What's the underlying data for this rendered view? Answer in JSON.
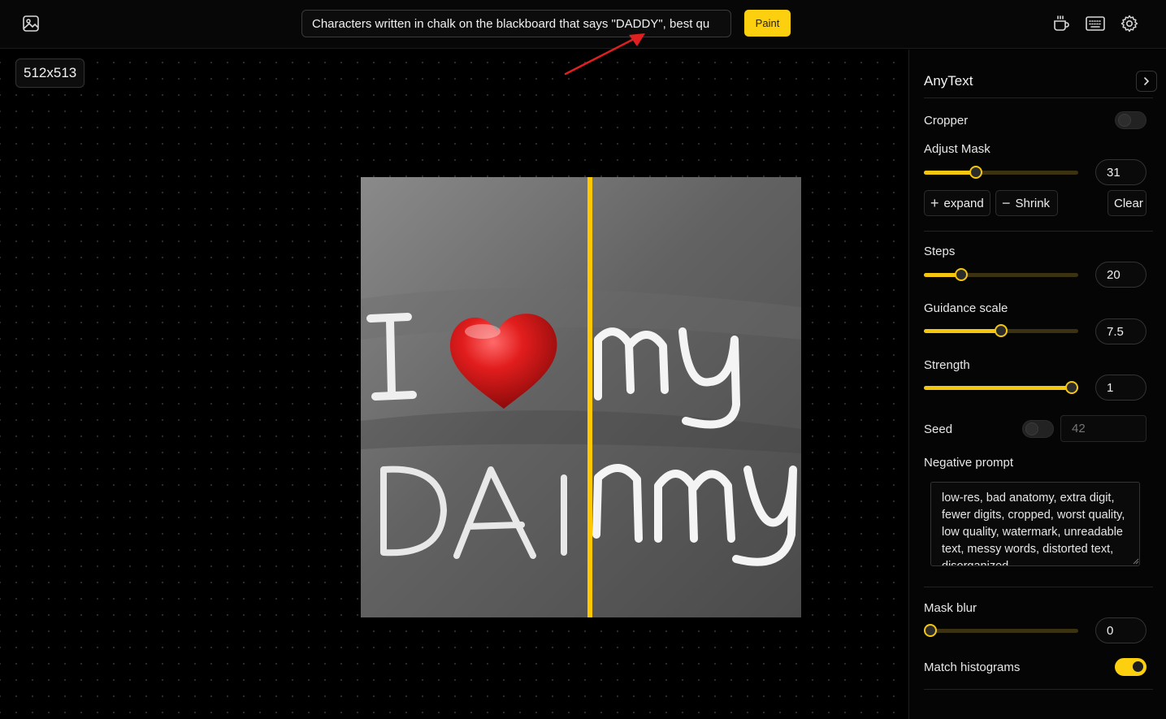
{
  "topbar": {
    "prompt_value": "Characters written in chalk on the blackboard that says \"DADDY\", best qu",
    "paint_label": "Paint",
    "icons": [
      "image-icon",
      "coffee-icon",
      "keyboard-icon",
      "gear-icon"
    ]
  },
  "canvas": {
    "size_badge": "512x513",
    "comparison_split": 0.52
  },
  "sidebar": {
    "title": "AnyText",
    "cropper": {
      "label": "Cropper",
      "on": false
    },
    "adjust_mask": {
      "label": "Adjust Mask",
      "value": "31",
      "fraction": 0.32
    },
    "buttons": {
      "expand": "expand",
      "shrink": "Shrink",
      "clear": "Clear"
    },
    "steps": {
      "label": "Steps",
      "value": "20",
      "fraction": 0.22
    },
    "guidance": {
      "label": "Guidance scale",
      "value": "7.5",
      "fraction": 0.5
    },
    "strength": {
      "label": "Strength",
      "value": "1",
      "fraction": 1.0
    },
    "seed": {
      "label": "Seed",
      "on": false,
      "placeholder": "42"
    },
    "negative_prompt": {
      "label": "Negative prompt",
      "value": "low-res, bad anatomy, extra digit, fewer digits, cropped, worst quality, low quality, watermark, unreadable text, messy words, distorted text, disorganized"
    },
    "mask_blur": {
      "label": "Mask blur",
      "value": "0",
      "fraction": 0.0
    },
    "match_histograms": {
      "label": "Match histograms",
      "on": true
    }
  },
  "colors": {
    "accent": "#fccf0f",
    "background": "#000000",
    "annotation_arrow": "#e02020"
  }
}
